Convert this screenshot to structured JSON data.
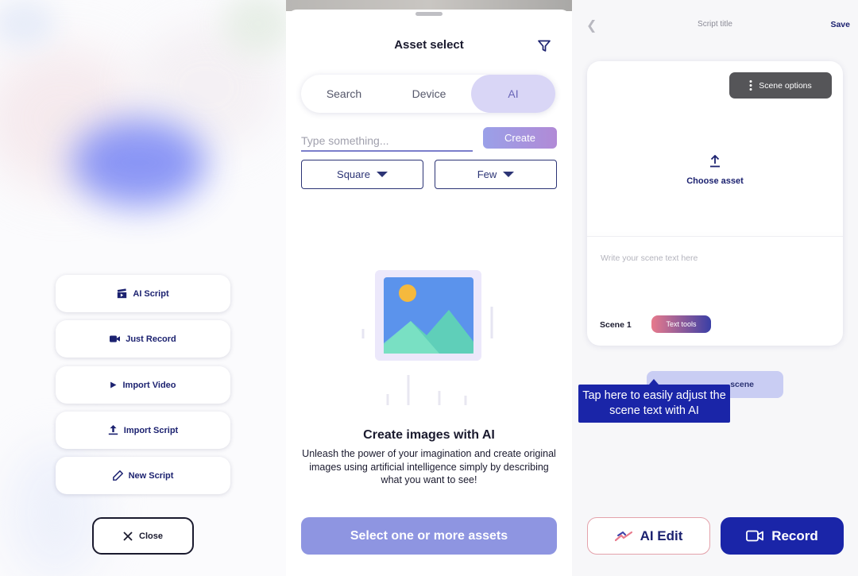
{
  "menu_panel": {
    "items": [
      {
        "label": "AI Script",
        "icon": "clapperboard-icon"
      },
      {
        "label": "Just Record",
        "icon": "video-camera-icon"
      },
      {
        "label": "Import Video",
        "icon": "play-icon"
      },
      {
        "label": "Import Script",
        "icon": "upload-icon"
      },
      {
        "label": "New Script",
        "icon": "pencil-icon"
      }
    ],
    "close_label": "Close"
  },
  "asset_panel": {
    "title": "Asset select",
    "tabs": [
      {
        "label": "Search",
        "active": false
      },
      {
        "label": "Device",
        "active": false
      },
      {
        "label": "AI",
        "active": true
      }
    ],
    "prompt_placeholder": "Type something...",
    "create_label": "Create",
    "shape_dropdown": "Square",
    "count_dropdown": "Few",
    "empty_title": "Create images with AI",
    "empty_description": "Unleash the power of your imagination and create original images using artificial intelligence simply by describing what you want to see!",
    "select_button": "Select one or more assets"
  },
  "editor_panel": {
    "header_title": "Script title",
    "save_label": "Save",
    "scene_options_label": "Scene options",
    "choose_asset_label": "Choose asset",
    "scene_text_placeholder": "Write your scene text here",
    "scene_label": "Scene 1",
    "text_tools_label": "Text tools",
    "add_scene_label": "scene",
    "tooltip_text": "Tap here to easily adjust the scene text with AI",
    "ai_edit_label": "AI Edit",
    "record_label": "Record"
  },
  "colors": {
    "brand_navy": "#1c2270",
    "primary_blue": "#1a25a8",
    "lavender": "#d9d6f6",
    "select_button": "#8e95e1"
  }
}
